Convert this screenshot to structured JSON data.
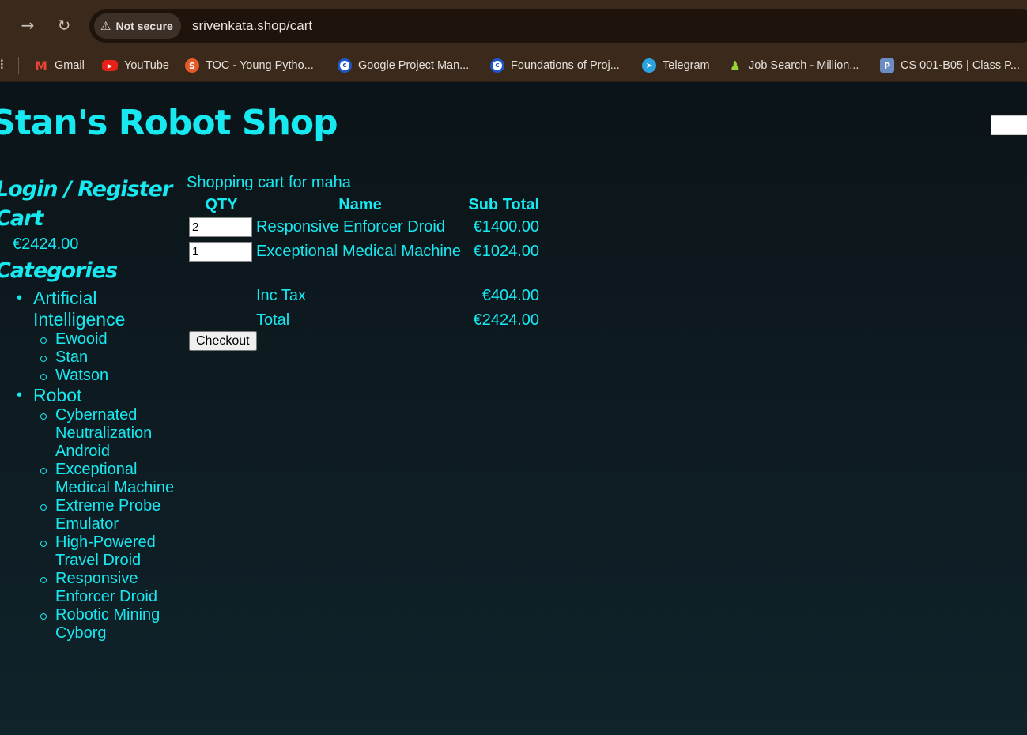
{
  "browser": {
    "security_label": "Not secure",
    "url": "srivenkata.shop/cart",
    "bookmarks": [
      {
        "label": "Gmail",
        "icon": "gmail-icon"
      },
      {
        "label": "YouTube",
        "icon": "youtube-icon"
      },
      {
        "label": "TOC - Young Pytho...",
        "icon": "toc-icon"
      },
      {
        "label": "Google Project Man...",
        "icon": "coursera-icon"
      },
      {
        "label": "Foundations of Proj...",
        "icon": "coursera-icon"
      },
      {
        "label": "Telegram",
        "icon": "telegram-icon"
      },
      {
        "label": "Job Search - Million...",
        "icon": "job-search-icon"
      },
      {
        "label": "CS 001-B05 | Class P...",
        "icon": "piazza-icon"
      }
    ]
  },
  "site": {
    "title": "Stan's Robot Shop"
  },
  "sidebar": {
    "login_label": "Login / Register",
    "cart_label": "Cart",
    "cart_total": "€2424.00",
    "categories_label": "Categories",
    "categories": [
      {
        "name": "Artificial Intelligence",
        "items": [
          "Ewooid",
          "Stan",
          "Watson"
        ]
      },
      {
        "name": "Robot",
        "items": [
          "Cybernated Neutralization Android",
          "Exceptional Medical Machine",
          "Extreme Probe Emulator",
          "High-Powered Travel Droid",
          "Responsive Enforcer Droid",
          "Robotic Mining Cyborg"
        ]
      }
    ]
  },
  "cart": {
    "caption": "Shopping cart for maha",
    "columns": {
      "qty": "QTY",
      "name": "Name",
      "subtotal": "Sub Total"
    },
    "rows": [
      {
        "qty": "2",
        "name": "Responsive Enforcer Droid",
        "subtotal": "€1400.00"
      },
      {
        "qty": "1",
        "name": "Exceptional Medical Machine",
        "subtotal": "€1024.00"
      }
    ],
    "tax_label": "Inc Tax",
    "tax_value": "€404.00",
    "total_label": "Total",
    "total_value": "€2424.00",
    "checkout_label": "Checkout"
  },
  "colors": {
    "accent": "#18e8f0",
    "page_bg": "#0f181c",
    "chrome_bg": "#3b2a1c"
  }
}
